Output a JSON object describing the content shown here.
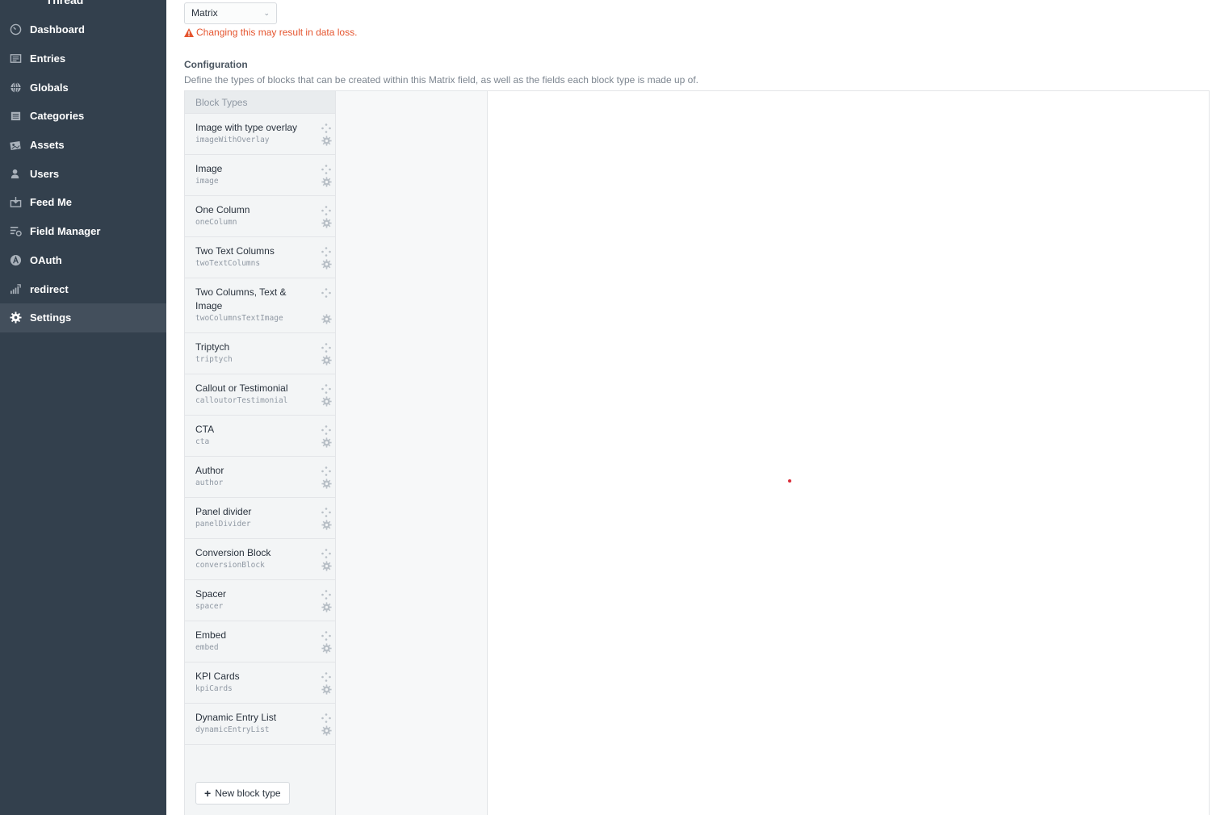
{
  "sidebar": {
    "site_name": "Thread",
    "items": [
      {
        "label": "Dashboard",
        "icon": "gauge-icon"
      },
      {
        "label": "Entries",
        "icon": "newspaper-icon"
      },
      {
        "label": "Globals",
        "icon": "globe-icon"
      },
      {
        "label": "Categories",
        "icon": "categories-icon"
      },
      {
        "label": "Assets",
        "icon": "assets-icon"
      },
      {
        "label": "Users",
        "icon": "users-icon"
      },
      {
        "label": "Feed Me",
        "icon": "feed-me-icon"
      },
      {
        "label": "Field Manager",
        "icon": "field-manager-icon"
      },
      {
        "label": "OAuth",
        "icon": "oauth-icon"
      },
      {
        "label": "redirect",
        "icon": "redirect-icon"
      },
      {
        "label": "Settings",
        "icon": "gear-icon",
        "selected": true
      }
    ]
  },
  "field_type": {
    "selected": "Matrix",
    "warning": "Changing this may result in data loss."
  },
  "configuration": {
    "heading": "Configuration",
    "instructions": "Define the types of blocks that can be created within this Matrix field, as well as the fields each block type is made up of.",
    "block_types_heading": "Block Types",
    "block_types": [
      {
        "name": "Image with type overlay",
        "handle": "imageWithOverlay"
      },
      {
        "name": "Image",
        "handle": "image"
      },
      {
        "name": "One Column",
        "handle": "oneColumn"
      },
      {
        "name": "Two Text Columns",
        "handle": "twoTextColumns"
      },
      {
        "name": "Two Columns, Text & Image",
        "handle": "twoColumnsTextImage"
      },
      {
        "name": "Triptych",
        "handle": "triptych"
      },
      {
        "name": "Callout or Testimonial",
        "handle": "calloutorTestimonial"
      },
      {
        "name": "CTA",
        "handle": "cta"
      },
      {
        "name": "Author",
        "handle": "author"
      },
      {
        "name": "Panel divider",
        "handle": "panelDivider"
      },
      {
        "name": "Conversion Block",
        "handle": "conversionBlock"
      },
      {
        "name": "Spacer",
        "handle": "spacer"
      },
      {
        "name": "Embed",
        "handle": "embed"
      },
      {
        "name": "KPI Cards",
        "handle": "kpiCards"
      },
      {
        "name": "Dynamic Entry List",
        "handle": "dynamicEntryList"
      }
    ],
    "new_block_type_label": "New block type"
  },
  "colors": {
    "sidebar_bg": "#33404d",
    "sidebar_selected": "#434f5c",
    "warning": "#e5552f"
  }
}
